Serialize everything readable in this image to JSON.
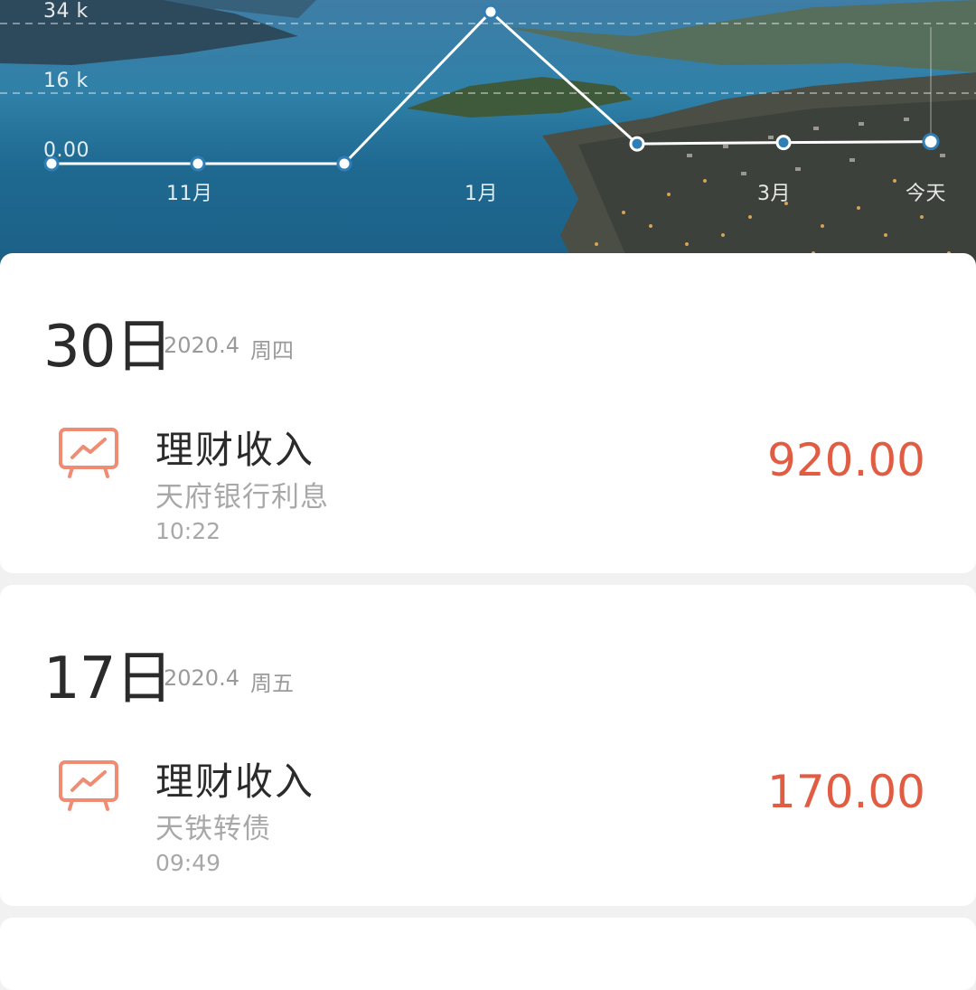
{
  "chart_data": {
    "type": "line",
    "y_ticks": [
      "34 k",
      "16 k",
      "0.00"
    ],
    "x_tick_labels": [
      "11月",
      "1月",
      "3月",
      "今天"
    ],
    "values": [
      0,
      0,
      0,
      37000,
      4500,
      4800,
      5000
    ],
    "grid": true,
    "colors": {
      "line": "#ffffff",
      "highlight_point": "#2f7fb6"
    }
  },
  "records": [
    {
      "day": "30日",
      "date": "2020.4",
      "weekday": "周四",
      "transaction": {
        "icon": "chart-trend-icon",
        "title": "理财收入",
        "subtitle": "天府银行利息",
        "time": "10:22",
        "amount": "920.00"
      }
    },
    {
      "day": "17日",
      "date": "2020.4",
      "weekday": "周五",
      "transaction": {
        "icon": "chart-trend-icon",
        "title": "理财收入",
        "subtitle": "天铁转债",
        "time": "09:49",
        "amount": "170.00"
      }
    }
  ],
  "colors": {
    "accent": "#e05d44",
    "icon": "#ef8c73"
  }
}
